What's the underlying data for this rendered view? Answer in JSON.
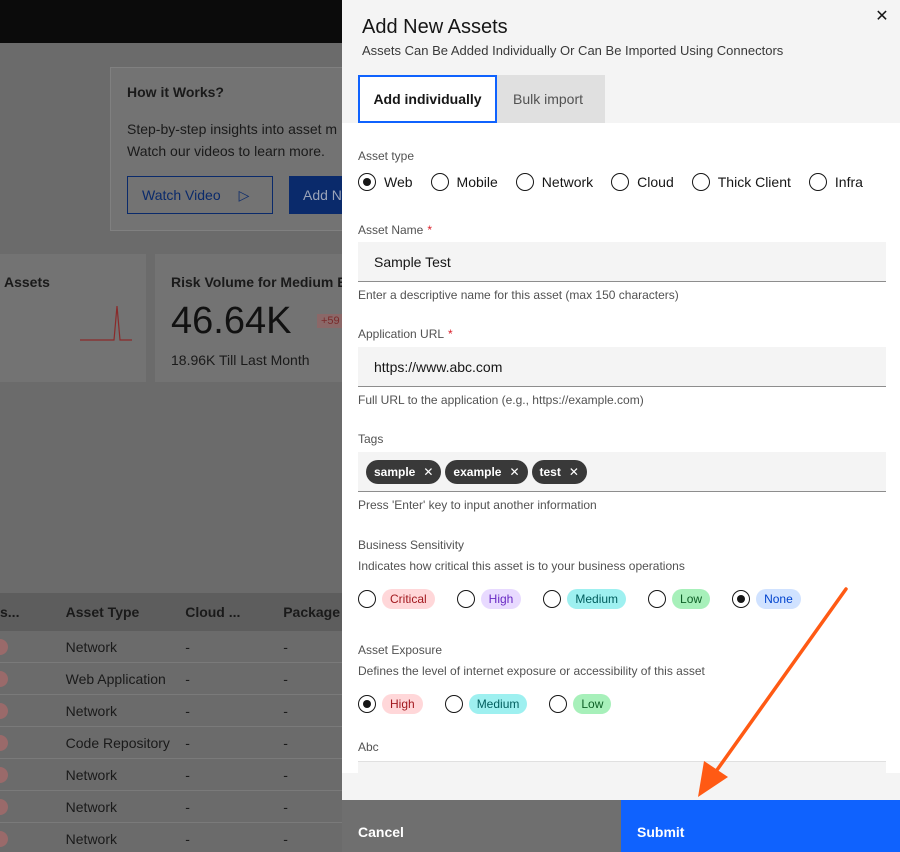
{
  "background": {
    "how_card": {
      "title": "How it Works?",
      "text": "Step-by-step insights into asset m Watch our videos to learn more.",
      "watch_label": "Watch Video",
      "add_label": "Add N"
    },
    "stat_left_title": "Assets",
    "stat_right": {
      "title": "Risk Volume for Medium E",
      "value": "46.64K",
      "badge": "+59",
      "sub": "18.96K Till Last Month"
    },
    "table": {
      "headers": [
        "s...",
        "Asset Type",
        "Cloud ...",
        "Package"
      ],
      "rows": [
        [
          "",
          "Network",
          "-",
          "-"
        ],
        [
          "",
          "Web Application",
          "-",
          "-"
        ],
        [
          "",
          "Network",
          "-",
          "-"
        ],
        [
          "",
          "Code Repository",
          "-",
          "-"
        ],
        [
          "",
          "Network",
          "-",
          "-"
        ],
        [
          "",
          "Network",
          "-",
          "-"
        ],
        [
          "",
          "Network",
          "-",
          "-"
        ]
      ]
    }
  },
  "drawer": {
    "title": "Add New Assets",
    "subtitle": "Assets Can Be Added Individually Or Can Be Imported Using Connectors",
    "close_icon": "close-icon",
    "tabs": [
      {
        "label": "Add individually",
        "active": true
      },
      {
        "label": "Bulk import",
        "active": false
      }
    ],
    "asset_type": {
      "label": "Asset type",
      "options": [
        "Web",
        "Mobile",
        "Network",
        "Cloud",
        "Thick Client",
        "Infra"
      ],
      "selected": "Web"
    },
    "asset_name": {
      "label": "Asset Name",
      "required_mark": "*",
      "value": "Sample Test",
      "helper": "Enter a descriptive name for this asset (max 150 characters)"
    },
    "application_url": {
      "label": "Application URL",
      "required_mark": "*",
      "value": "https://www.abc.com",
      "helper": "Full URL to the application (e.g., https://example.com)"
    },
    "tags": {
      "label": "Tags",
      "items": [
        "sample",
        "example",
        "test"
      ],
      "helper": "Press 'Enter' key to input another information"
    },
    "business_sensitivity": {
      "label": "Business Sensitivity",
      "description": "Indicates how critical this asset is to your business operations",
      "options": [
        "Critical",
        "High",
        "Medium",
        "Low",
        "None"
      ],
      "selected": "None"
    },
    "asset_exposure": {
      "label": "Asset Exposure",
      "description": "Defines the level of internet exposure or accessibility of this asset",
      "options": [
        "High",
        "Medium",
        "Low"
      ],
      "selected": "High"
    },
    "abc_label": "Abc",
    "footer": {
      "cancel_label": "Cancel",
      "submit_label": "Submit"
    }
  },
  "colors": {
    "accent": "#0f62fe",
    "annotation_arrow": "#ff5a14"
  }
}
